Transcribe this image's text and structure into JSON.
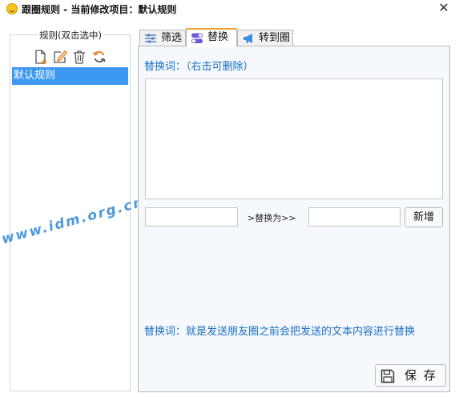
{
  "window": {
    "title": "跟圈规则 - 当前修改项目：默认规则",
    "close_glyph": "✕"
  },
  "rules_panel": {
    "legend": "规则(双击选中)",
    "toolbar": [
      {
        "name": "new-rule-icon",
        "icon": "new-file"
      },
      {
        "name": "edit-rule-icon",
        "icon": "edit"
      },
      {
        "name": "delete-rule-icon",
        "icon": "trash"
      },
      {
        "name": "refresh-rule-icon",
        "icon": "refresh"
      }
    ],
    "items": [
      {
        "label": "默认规则",
        "selected": true
      }
    ]
  },
  "watermark": "www.idm.org.cn",
  "tabs": [
    {
      "label": "筛选",
      "icon": "filter-sliders-icon",
      "active": false
    },
    {
      "label": "替换",
      "icon": "toggle-switch-icon",
      "active": true
    },
    {
      "label": "转到圈",
      "icon": "megaphone-icon",
      "active": false
    }
  ],
  "replace_tab": {
    "words_label": "替换词：（右击可删除）",
    "words_list": [],
    "source_value": "",
    "replace_to_label": ">替换为>>",
    "target_value": "",
    "add_button": "新增",
    "hint": "替换词：就是发送朋友圈之前会把发送的文本内容进行替换",
    "save_button": "保 存"
  },
  "colors": {
    "accent_blue": "#1a6fc4",
    "selection_blue": "#3c98f0",
    "active_tab_top": "#f0a030",
    "toolbar_orange": "#f07d1a"
  }
}
